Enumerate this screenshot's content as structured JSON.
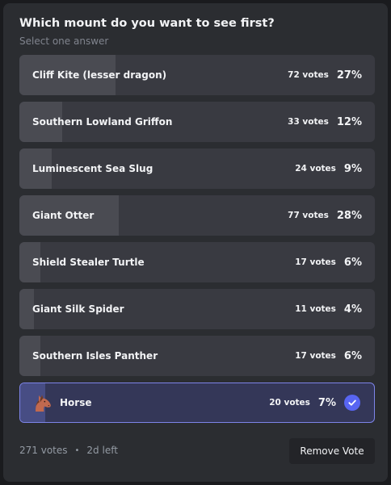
{
  "poll": {
    "question": "Which mount do you want to see first?",
    "subtitle": "Select one answer",
    "answers": [
      {
        "label": "Cliff Kite (lesser dragon)",
        "votes": "72 votes",
        "percent": "27%",
        "share": 0.27,
        "selected": false
      },
      {
        "label": "Southern Lowland Griffon",
        "votes": "33 votes",
        "percent": "12%",
        "share": 0.12,
        "selected": false
      },
      {
        "label": "Luminescent Sea Slug",
        "votes": "24 votes",
        "percent": "9%",
        "share": 0.09,
        "selected": false
      },
      {
        "label": "Giant Otter",
        "votes": "77 votes",
        "percent": "28%",
        "share": 0.28,
        "selected": false
      },
      {
        "label": "Shield Stealer Turtle",
        "votes": "17 votes",
        "percent": "6%",
        "share": 0.06,
        "selected": false
      },
      {
        "label": "Giant Silk Spider",
        "votes": "11 votes",
        "percent": "4%",
        "share": 0.04,
        "selected": false
      },
      {
        "label": "Southern Isles Panther",
        "votes": "17 votes",
        "percent": "6%",
        "share": 0.06,
        "selected": false
      },
      {
        "label": "Horse",
        "votes": "20 votes",
        "percent": "7%",
        "share": 0.07,
        "selected": true,
        "emoji": "horse-face-icon"
      }
    ],
    "footer": {
      "total_votes": "271 votes",
      "separator": "•",
      "time_left": "2d left"
    },
    "remove_vote_label": "Remove Vote"
  },
  "colors": {
    "page_background": "#1a1b1e",
    "card_background": "#2b2d31",
    "answer_background": "#393a41",
    "answer_fill": "#4a4b52",
    "selected_background": "#343758",
    "selected_fill": "#474d84",
    "selected_border": "#7d84e8",
    "accent": "#5865f2",
    "muted_text": "#80848e"
  }
}
